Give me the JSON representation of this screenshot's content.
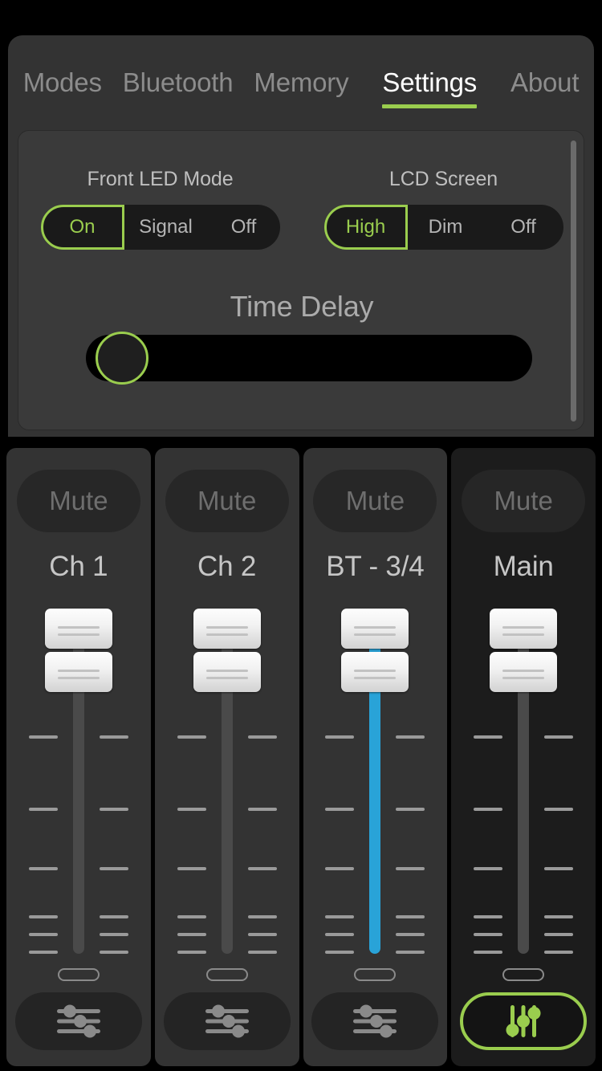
{
  "colors": {
    "accent_green": "#9ACD4E",
    "bt_blue": "#29A3D8",
    "panel_bg": "#333333",
    "card_bg": "#3a3a3a",
    "app_bg": "#000000",
    "main_strip_bg": "#1c1c1c"
  },
  "tabs": [
    {
      "label": "Modes",
      "active": false
    },
    {
      "label": "Bluetooth",
      "active": false
    },
    {
      "label": "Memory",
      "active": false
    },
    {
      "label": "Settings",
      "active": true
    },
    {
      "label": "About",
      "active": false
    }
  ],
  "settings": {
    "front_led_mode": {
      "label": "Front LED Mode",
      "options": [
        "On",
        "Signal",
        "Off"
      ],
      "selected": "On"
    },
    "lcd_screen": {
      "label": "LCD Screen",
      "options": [
        "High",
        "Dim",
        "Off"
      ],
      "selected": "High"
    },
    "time_delay": {
      "label": "Time Delay",
      "value_percent": 0
    }
  },
  "mixer": {
    "mute_label": "Mute",
    "channels": [
      {
        "name": "Ch 1",
        "muted": false,
        "fader_position_percent": 100,
        "track_color": "#4a4a4a",
        "eq_selected": false,
        "eq_icon": "horizontal-sliders-icon"
      },
      {
        "name": "Ch 2",
        "muted": false,
        "fader_position_percent": 100,
        "track_color": "#4a4a4a",
        "eq_selected": false,
        "eq_icon": "horizontal-sliders-icon"
      },
      {
        "name": "BT - 3/4",
        "muted": false,
        "fader_position_percent": 100,
        "track_color": "#29A3D8",
        "eq_selected": false,
        "eq_icon": "horizontal-sliders-icon"
      },
      {
        "name": "Main",
        "muted": false,
        "fader_position_percent": 100,
        "track_color": "#4a4a4a",
        "eq_selected": true,
        "eq_icon": "vertical-sliders-icon"
      }
    ],
    "fader_tick_offsets_percent": [
      36,
      59,
      77,
      90,
      95,
      99,
      103
    ]
  }
}
